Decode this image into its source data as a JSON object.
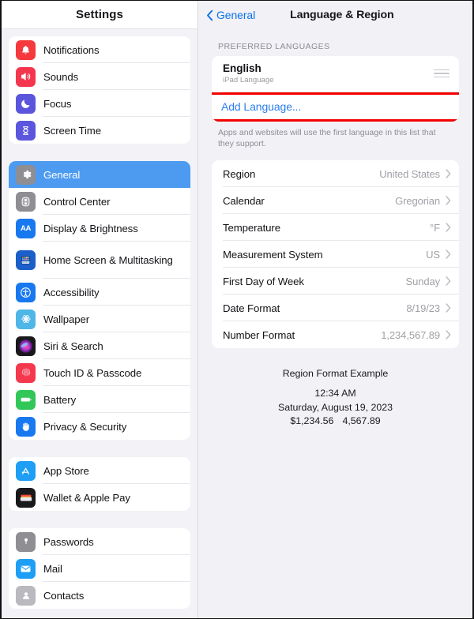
{
  "sidebar": {
    "title": "Settings",
    "groups": [
      {
        "items": [
          {
            "label": "Notifications",
            "icon": "bell-icon"
          },
          {
            "label": "Sounds",
            "icon": "speaker-icon"
          },
          {
            "label": "Focus",
            "icon": "moon-icon"
          },
          {
            "label": "Screen Time",
            "icon": "hourglass-icon"
          }
        ]
      },
      {
        "items": [
          {
            "label": "General",
            "icon": "gear-icon",
            "selected": true
          },
          {
            "label": "Control Center",
            "icon": "sliders-icon"
          },
          {
            "label": "Display & Brightness",
            "icon": "aa-icon"
          },
          {
            "label": "Home Screen & Multitasking",
            "icon": "home-screen-icon",
            "tall": true
          },
          {
            "label": "Accessibility",
            "icon": "accessibility-icon"
          },
          {
            "label": "Wallpaper",
            "icon": "wallpaper-icon"
          },
          {
            "label": "Siri & Search",
            "icon": "siri-icon"
          },
          {
            "label": "Touch ID & Passcode",
            "icon": "fingerprint-icon"
          },
          {
            "label": "Battery",
            "icon": "battery-icon"
          },
          {
            "label": "Privacy & Security",
            "icon": "hand-icon"
          }
        ]
      },
      {
        "items": [
          {
            "label": "App Store",
            "icon": "app-store-icon"
          },
          {
            "label": "Wallet & Apple Pay",
            "icon": "wallet-icon"
          }
        ]
      },
      {
        "items": [
          {
            "label": "Passwords",
            "icon": "key-icon"
          },
          {
            "label": "Mail",
            "icon": "mail-icon"
          },
          {
            "label": "Contacts",
            "icon": "contacts-icon"
          }
        ]
      }
    ]
  },
  "detail": {
    "back_label": "General",
    "title": "Language & Region",
    "preferred_languages_header": "PREFERRED LANGUAGES",
    "language": {
      "name": "English",
      "subtitle": "iPad Language"
    },
    "add_language_label": "Add Language...",
    "footnote": "Apps and websites will use the first language in this list that they support.",
    "region_rows": [
      {
        "label": "Region",
        "value": "United States"
      },
      {
        "label": "Calendar",
        "value": "Gregorian"
      },
      {
        "label": "Temperature",
        "value": "°F"
      },
      {
        "label": "Measurement System",
        "value": "US"
      },
      {
        "label": "First Day of Week",
        "value": "Sunday"
      },
      {
        "label": "Date Format",
        "value": "8/19/23"
      },
      {
        "label": "Number Format",
        "value": "1,234,567.89"
      }
    ],
    "example": {
      "title": "Region Format Example",
      "time": "12:34 AM",
      "date": "Saturday, August 19, 2023",
      "currency": "$1,234.56",
      "number": "4,567.89"
    }
  },
  "colors": {
    "accent_blue": "#0a73ec",
    "selection_blue": "#4c9bf0",
    "highlight_red": "#f40000"
  }
}
